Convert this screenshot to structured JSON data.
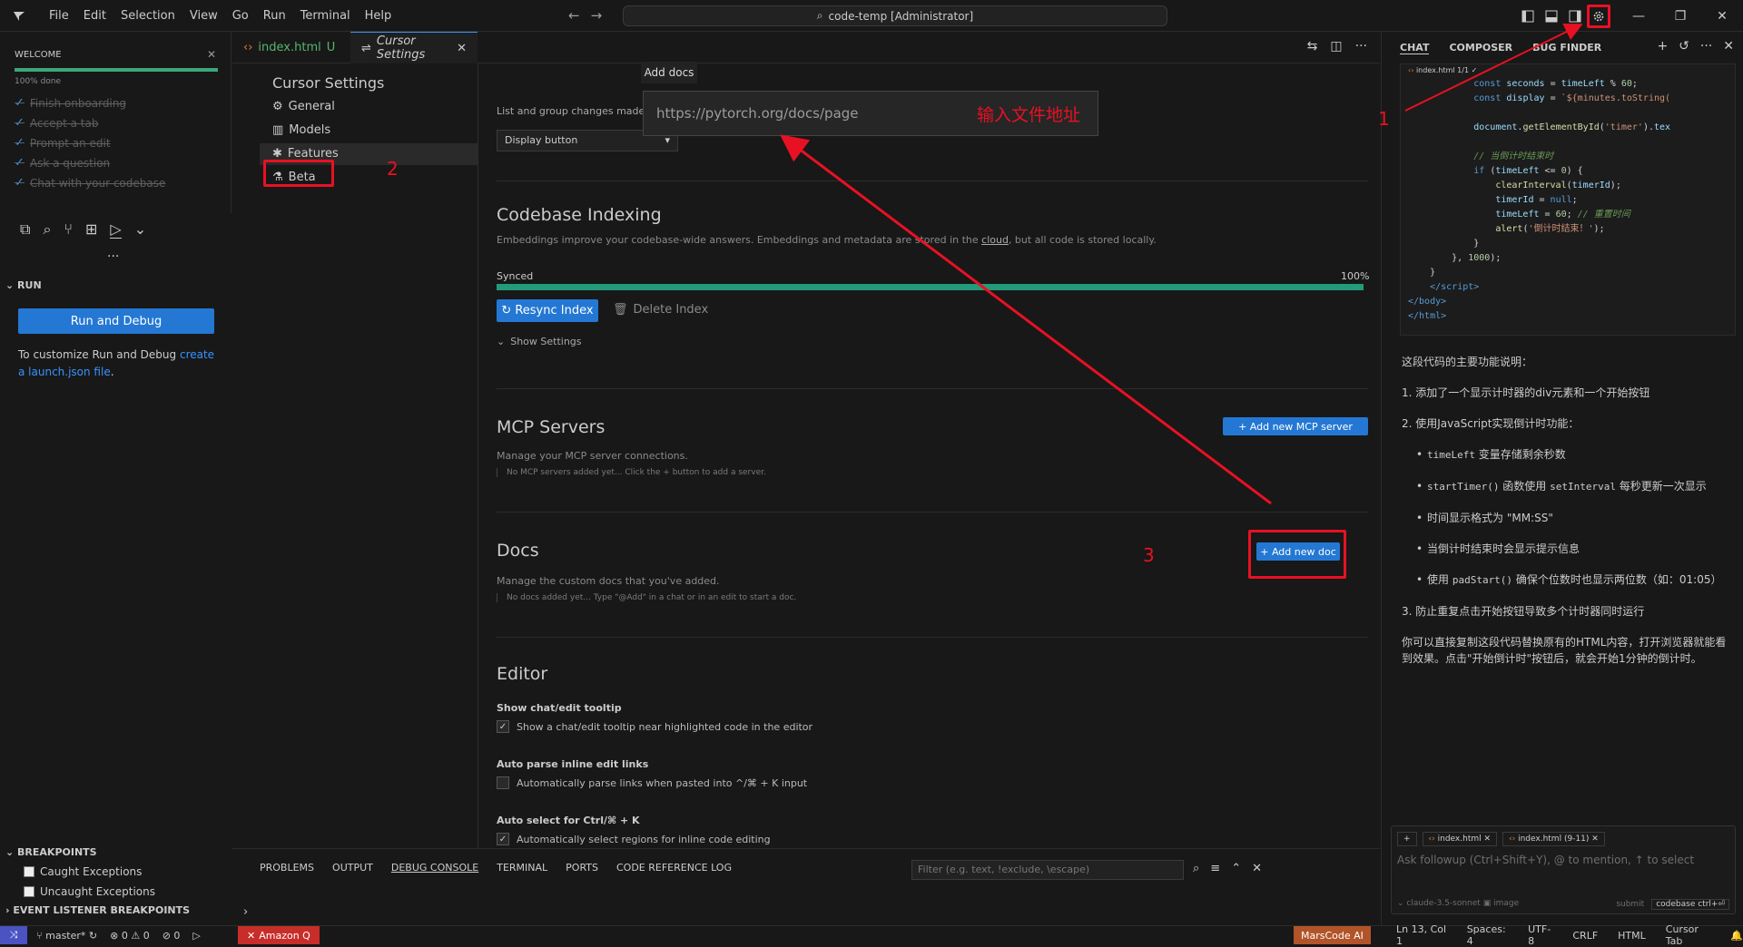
{
  "titlebar": {
    "menus": [
      "File",
      "Edit",
      "Selection",
      "View",
      "Go",
      "Run",
      "Terminal",
      "Help"
    ],
    "command_center": "code-temp [Administrator]",
    "icons": [
      "toggle-primary-sidebar-icon",
      "toggle-panel-icon",
      "toggle-secondary-sidebar-icon",
      "gear-icon"
    ]
  },
  "welcome": {
    "header": "WELCOME",
    "progress_fraction": 1.0,
    "progress_text": "100% done",
    "steps": [
      "Finish onboarding",
      "Accept a tab",
      "Prompt an edit",
      "Ask a question",
      "Chat with your codebase"
    ]
  },
  "run": {
    "header": "RUN",
    "button": "Run and Debug",
    "hint_text": "To customize Run and Debug ",
    "hint_link": "create a launch.json file",
    "hint_end": "."
  },
  "breakpoints": {
    "header": "BREAKPOINTS",
    "items": [
      "Caught Exceptions",
      "Uncaught Exceptions"
    ],
    "event_listener": "EVENT LISTENER BREAKPOINTS"
  },
  "tabs": [
    {
      "label": "index.html",
      "badge": "U"
    },
    {
      "label": "Cursor Settings"
    }
  ],
  "settings_nav": {
    "title": "Cursor Settings",
    "items": [
      "General",
      "Models",
      "Features",
      "Beta"
    ]
  },
  "settings": {
    "partial_text": "List and group changes made in",
    "display_select": "Display button",
    "codebase": {
      "title": "Codebase Indexing",
      "subtitle_a": "Embeddings improve your codebase-wide answers. Embeddings and metadata are stored in the ",
      "subtitle_link": "cloud",
      "subtitle_b": ", but all code is stored locally.",
      "status": "Synced",
      "percent_text": "100%",
      "progress_fraction": 1.0,
      "resync": "Resync Index",
      "delete": "Delete Index",
      "show_settings": "Show Settings"
    },
    "mcp": {
      "title": "MCP Servers",
      "subtitle": "Manage your MCP server connections.",
      "empty": "No MCP servers added yet... Click the + button to add a server.",
      "button": "+ Add new MCP server"
    },
    "docs": {
      "title": "Docs",
      "subtitle": "Manage the custom docs that you've added.",
      "empty": "No docs added yet... Type \"@Add\" in a chat or in an edit to start a doc.",
      "button": "+ Add new doc"
    },
    "editor": {
      "title": "Editor",
      "options": [
        {
          "title": "Show chat/edit tooltip",
          "label": "Show a chat/edit tooltip near highlighted code in the editor",
          "checked": true
        },
        {
          "title": "Auto parse inline edit links",
          "label": "Automatically parse links when pasted into ^/⌘ + K input",
          "checked": false
        },
        {
          "title": "Auto select for Ctrl/⌘ + K",
          "label": "Automatically select regions for inline code editing",
          "checked": true
        }
      ]
    }
  },
  "add_docs": {
    "tooltip": "Add docs",
    "placeholder": "https://pytorch.org/docs/page",
    "note": "输入文件地址"
  },
  "annotations": [
    "1",
    "2",
    "3"
  ],
  "panel": {
    "tabs": [
      "PROBLEMS",
      "OUTPUT",
      "DEBUG CONSOLE",
      "TERMINAL",
      "PORTS",
      "CODE REFERENCE LOG"
    ],
    "filter_placeholder": "Filter (e.g. text, !exclude, \\escape)"
  },
  "chat": {
    "tabs": [
      "CHAT",
      "COMPOSER",
      "BUG FINDER"
    ],
    "code_file": "index.html",
    "code_range": "1/1",
    "text": {
      "intro": "这段代码的主要功能说明：",
      "p1": "1. 添加了一个显示计时器的div元素和一个开始按钮",
      "p2": "2. 使用JavaScript实现倒计时功能：",
      "b1_code": "timeLeft",
      "b1_text": " 变量存储剩余秒数",
      "b2_code1": "startTimer()",
      "b2_mid": " 函数使用 ",
      "b2_code2": "setInterval",
      "b2_text": " 每秒更新一次显示",
      "b3": "时间显示格式为 \"MM:SS\"",
      "b4": "当倒计时结束时会显示提示信息",
      "b5_a": "使用 ",
      "b5_code": "padStart()",
      "b5_b": " 确保个位数时也显示两位数（如：01:05）",
      "p3": "3. 防止重复点击开始按钮导致多个计时器同时运行",
      "outro": "你可以直接复制这段代码替换原有的HTML内容，打开浏览器就能看到效果。点击\"开始倒计时\"按钮后，就会开始1分钟的倒计时。"
    },
    "input": {
      "chips": [
        "index.html",
        "index.html (9-11)"
      ],
      "placeholder": "Ask followup (Ctrl+Shift+Y), @ to mention, ↑ to select",
      "model": "claude-3.5-sonnet",
      "image": "image",
      "submit": "submit",
      "codebase": "codebase ctrl+⏎"
    }
  },
  "statusbar": {
    "branch": "master*",
    "problems": "⊗ 0 ⚠ 0",
    "ports": "0",
    "amazon": "Amazon Q",
    "marscode": "MarsCode AI",
    "position": "Ln 13, Col 1",
    "spaces": "Spaces: 4",
    "encoding": "UTF-8",
    "eol": "CRLF",
    "language": "HTML",
    "cursor_tab": "Cursor Tab"
  },
  "colors": {
    "accent": "#2478d4",
    "progress": "#3aa77a",
    "annotation": "#e81123"
  }
}
